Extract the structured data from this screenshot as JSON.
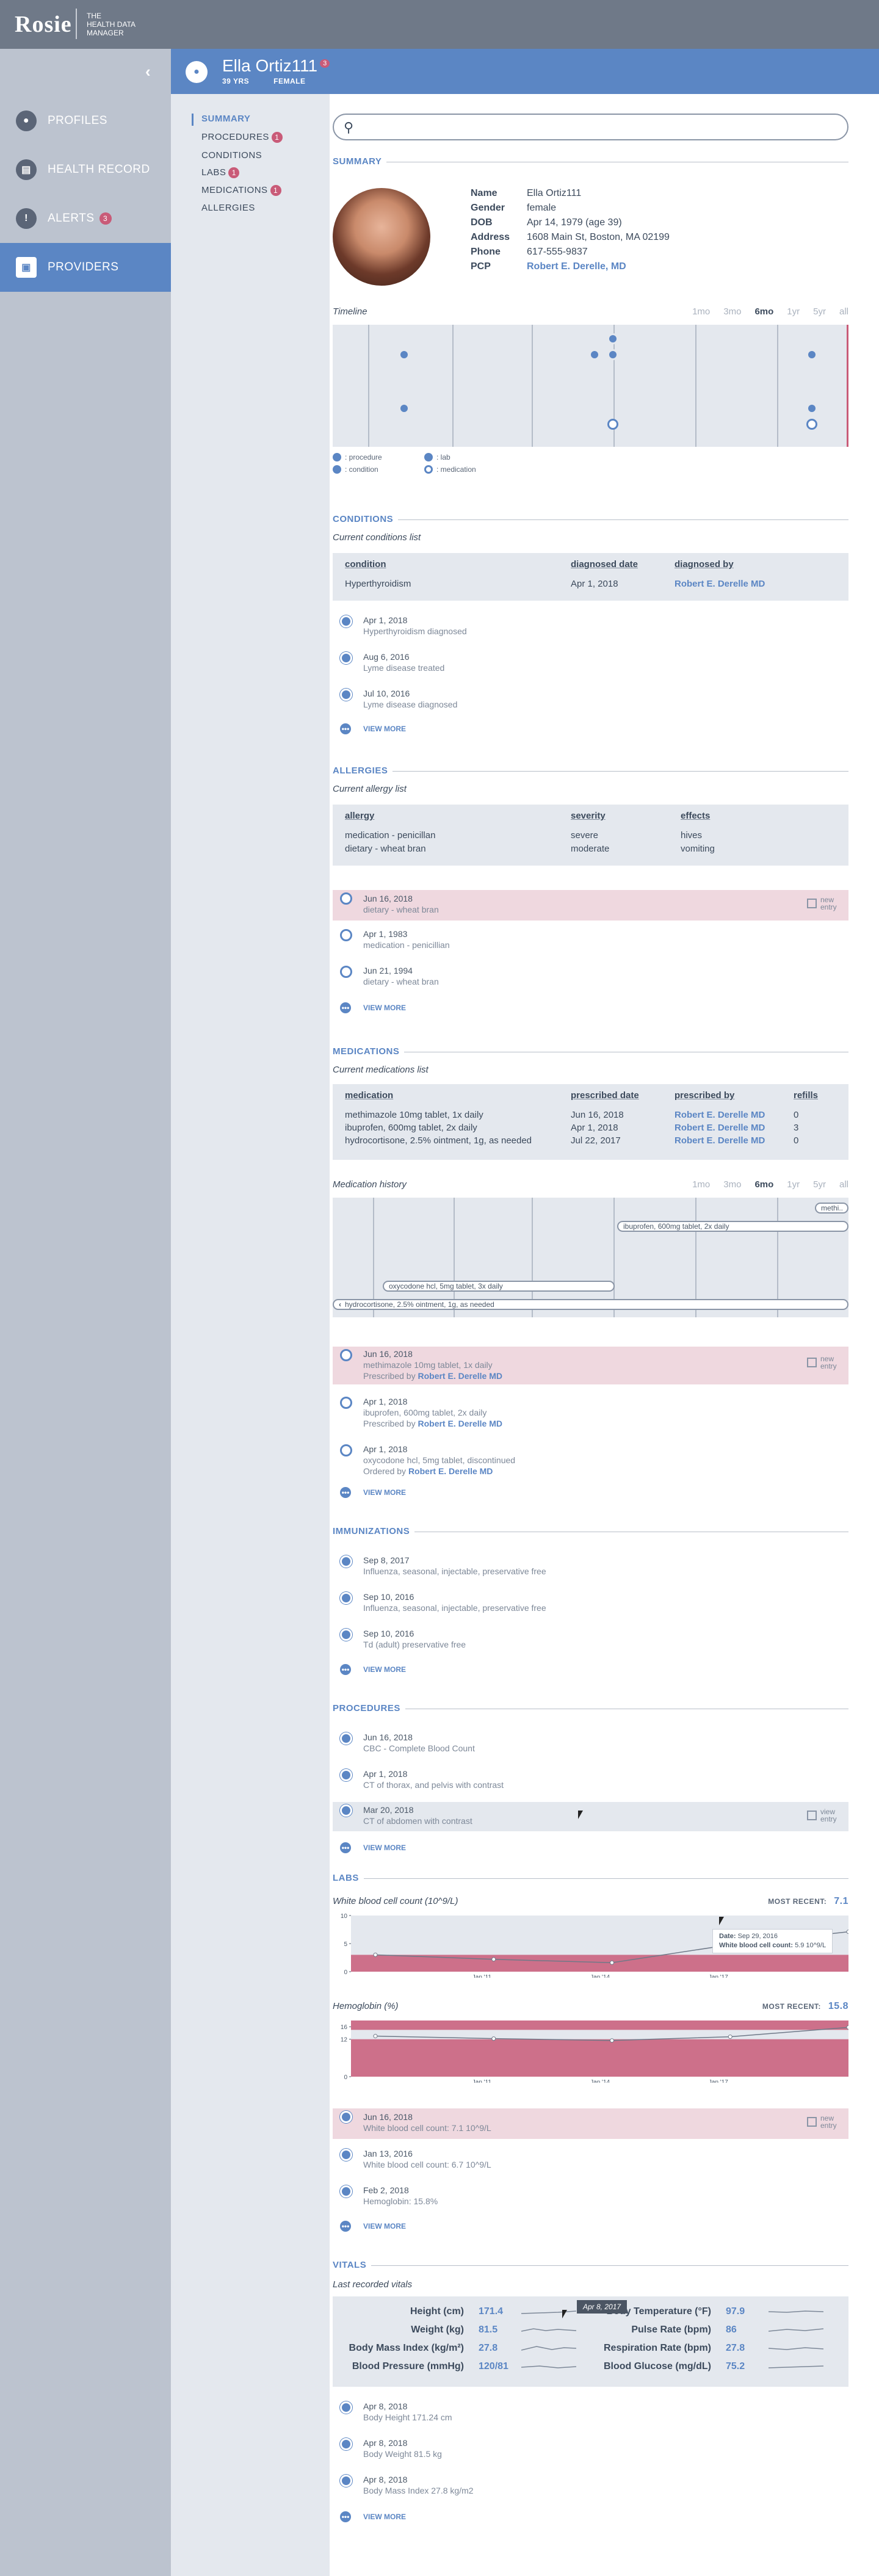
{
  "app": {
    "logo": "Rosie",
    "tagline": [
      "the",
      "HEALTH DATA",
      "MANAGER"
    ]
  },
  "sidebar": {
    "items": [
      {
        "label": "PROFILES",
        "icon": "person-icon"
      },
      {
        "label": "HEALTH RECORD",
        "icon": "clipboard-icon"
      },
      {
        "label": "ALERTS",
        "icon": "alert-icon",
        "badge": "3"
      },
      {
        "label": "PROVIDERS",
        "icon": "id-card-icon"
      }
    ]
  },
  "patient": {
    "name": "Ella Ortiz111",
    "badge": "3",
    "age": "39 YRS",
    "sex": "FEMALE"
  },
  "subnav": [
    {
      "label": "SUMMARY"
    },
    {
      "label": "PROCEDURES",
      "badge": "1"
    },
    {
      "label": "CONDITIONS"
    },
    {
      "label": "LABS",
      "badge": "1"
    },
    {
      "label": "MEDICATIONS",
      "badge": "1"
    },
    {
      "label": "ALLERGIES"
    }
  ],
  "summary": {
    "title": "SUMMARY",
    "fields": [
      {
        "k": "Name",
        "v": "Ella Ortiz111"
      },
      {
        "k": "Gender",
        "v": "female"
      },
      {
        "k": "DOB",
        "v": "Apr 14, 1979 (age 39)"
      },
      {
        "k": "Address",
        "v": "1608 Main St, Boston, MA 02199"
      },
      {
        "k": "Phone",
        "v": "617-555-9837"
      },
      {
        "k": "PCP",
        "v": "Robert E. Derelle, MD"
      }
    ],
    "timeline_title": "Timeline",
    "periods": [
      "1mo",
      "3mo",
      "6mo",
      "1yr",
      "5yr",
      "all"
    ],
    "legend": {
      "procedure": ": procedure",
      "lab": ": lab",
      "condition": ": condition",
      "medication": ": medication"
    }
  },
  "conditions": {
    "title": "CONDITIONS",
    "list_title": "Current conditions list",
    "headers": [
      "condition",
      "diagnosed date",
      "diagnosed by"
    ],
    "rows": [
      [
        "Hyperthyroidism",
        "Apr 1, 2018",
        "Robert E. Derelle MD"
      ]
    ],
    "entries": [
      {
        "date": "Apr 1, 2018",
        "text": "Hyperthyroidism diagnosed"
      },
      {
        "date": "Aug 6, 2016",
        "text": "Lyme disease treated"
      },
      {
        "date": "Jul 10, 2016",
        "text": "Lyme disease diagnosed"
      }
    ],
    "view_more": "VIEW MORE"
  },
  "allergies": {
    "title": "ALLERGIES",
    "list_title": "Current allergy list",
    "headers": [
      "allergy",
      "severity",
      "effects"
    ],
    "rows": [
      [
        "medication - penicillan",
        "severe",
        "hives"
      ],
      [
        "dietary - wheat bran",
        "moderate",
        "vomiting"
      ]
    ],
    "entries": [
      {
        "date": "Jun 16, 2018",
        "text": "dietary - wheat bran",
        "tag": "new entry"
      },
      {
        "date": "Apr 1, 1983",
        "text": "medication - penicillian"
      },
      {
        "date": "Jun 21, 1994",
        "text": "dietary - wheat bran"
      }
    ],
    "view_more": "VIEW MORE"
  },
  "medications": {
    "title": "MEDICATIONS",
    "list_title": "Current medications list",
    "headers": [
      "medication",
      "prescribed date",
      "prescribed by",
      "refills"
    ],
    "rows": [
      [
        "methimazole 10mg tablet, 1x daily",
        "Jun 16, 2018",
        "Robert E. Derelle MD",
        "0"
      ],
      [
        "ibuprofen, 600mg tablet, 2x daily",
        "Apr 1, 2018",
        "Robert E. Derelle MD",
        "3"
      ],
      [
        "hydrocortisone, 2.5% ointment, 1g, as needed",
        "Jul 22, 2017",
        "Robert E. Derelle MD",
        "0"
      ]
    ],
    "history_title": "Medication history",
    "periods": [
      "1mo",
      "3mo",
      "6mo",
      "1yr",
      "5yr",
      "all"
    ],
    "pills": [
      "methi..",
      "ibuprofen, 600mg tablet, 2x daily",
      "oxycodone hcl, 5mg tablet, 3x daily",
      "hydrocortisone, 2.5% ointment, 1g, as needed"
    ],
    "entries": [
      {
        "date": "Jun 16, 2018",
        "text": "methimazole 10mg tablet, 1x daily",
        "by_prefix": "Prescribed by ",
        "by": "Robert E. Derelle MD",
        "tag": "new entry"
      },
      {
        "date": "Apr 1, 2018",
        "text": "ibuprofen, 600mg tablet, 2x daily",
        "by_prefix": "Prescribed by ",
        "by": "Robert E. Derelle MD"
      },
      {
        "date": "Apr 1, 2018",
        "text": "oxycodone hcl, 5mg tablet, discontinued",
        "by_prefix": "Ordered by ",
        "by": "Robert E. Derelle MD"
      }
    ],
    "view_more": "VIEW MORE"
  },
  "immunizations": {
    "title": "IMMUNIZATIONS",
    "entries": [
      {
        "date": "Sep 8, 2017",
        "text": "Influenza, seasonal, injectable, preservative free"
      },
      {
        "date": "Sep 10, 2016",
        "text": "Influenza, seasonal, injectable, preservative free"
      },
      {
        "date": "Sep 10, 2016",
        "text": "Td (adult) preservative free"
      }
    ],
    "view_more": "VIEW MORE"
  },
  "procedures": {
    "title": "PROCEDURES",
    "entries": [
      {
        "date": "Jun 16, 2018",
        "text": "CBC - Complete Blood Count"
      },
      {
        "date": "Apr 1, 2018",
        "text": "CT of thorax, and pelvis with contrast"
      },
      {
        "date": "Mar 20, 2018",
        "text": "CT of abdomen with contrast",
        "tag": "view entry"
      }
    ],
    "view_more": "VIEW MORE"
  },
  "labs": {
    "title": "LABS",
    "most_recent_label": "MOST RECENT:",
    "entries": [
      {
        "date": "Jun 16, 2018",
        "text": "White blood cell count: 7.1 10^9/L",
        "tag": "new entry"
      },
      {
        "date": "Jan 13, 2016",
        "text": "White blood cell count: 6.7 10^9/L"
      },
      {
        "date": "Feb 2, 2018",
        "text": "Hemoglobin: 15.8%"
      }
    ],
    "tooltip": {
      "date_label": "Date:",
      "date": "Sep 29, 2016",
      "value_label": "White blood cell count:",
      "value": "5.9 10^9/L"
    },
    "view_more": "VIEW MORE"
  },
  "vitals": {
    "title": "VITALS",
    "list_title": "Last recorded vitals",
    "left": [
      {
        "k": "Height (cm)",
        "v": "171.4"
      },
      {
        "k": "Weight (kg)",
        "v": "81.5"
      },
      {
        "k": "Body Mass Index (kg/m²)",
        "v": "27.8"
      },
      {
        "k": "Blood Pressure (mmHg)",
        "v": "120/81"
      }
    ],
    "right": [
      {
        "k": "Body Temperature (°F)",
        "v": "97.9"
      },
      {
        "k": "Pulse Rate (bpm)",
        "v": "86"
      },
      {
        "k": "Respiration Rate (bpm)",
        "v": "27.8"
      },
      {
        "k": "Blood Glucose (mg/dL)",
        "v": "75.2"
      }
    ],
    "tooltip": "Apr 8, 2017",
    "entries": [
      {
        "date": "Apr 8, 2018",
        "text": "Body Height 171.24 cm"
      },
      {
        "date": "Apr 8, 2018",
        "text": "Body Weight 81.5 kg"
      },
      {
        "date": "Apr 8, 2018",
        "text": "Body Mass Index 27.8 kg/m2"
      }
    ],
    "view_more": "VIEW MORE"
  },
  "chart_data": [
    {
      "type": "line",
      "title": "White blood cell count (10^9/L)",
      "most_recent": "7.1",
      "x": [
        "2008",
        "2011",
        "2014",
        "2017",
        "2018"
      ],
      "series": [
        {
          "values": [
            3.0,
            2.2,
            1.6,
            4.8,
            7.1
          ]
        }
      ],
      "x_ticks": [
        "Jan '11",
        "Jan '14",
        "Jan '17"
      ],
      "y_ticks": [
        10,
        5,
        0
      ],
      "ylim": [
        0,
        10
      ]
    },
    {
      "type": "line",
      "title": "Hemoglobin (%)",
      "most_recent": "15.8",
      "x": [
        "2008",
        "2011",
        "2014",
        "2017",
        "2018"
      ],
      "series": [
        {
          "values": [
            13.0,
            12.2,
            11.6,
            12.8,
            15.8
          ]
        }
      ],
      "x_ticks": [
        "Jan '11",
        "Jan '14",
        "Jan '17"
      ],
      "y_ticks": [
        16,
        12,
        0
      ],
      "ylim": [
        0,
        18
      ]
    }
  ]
}
